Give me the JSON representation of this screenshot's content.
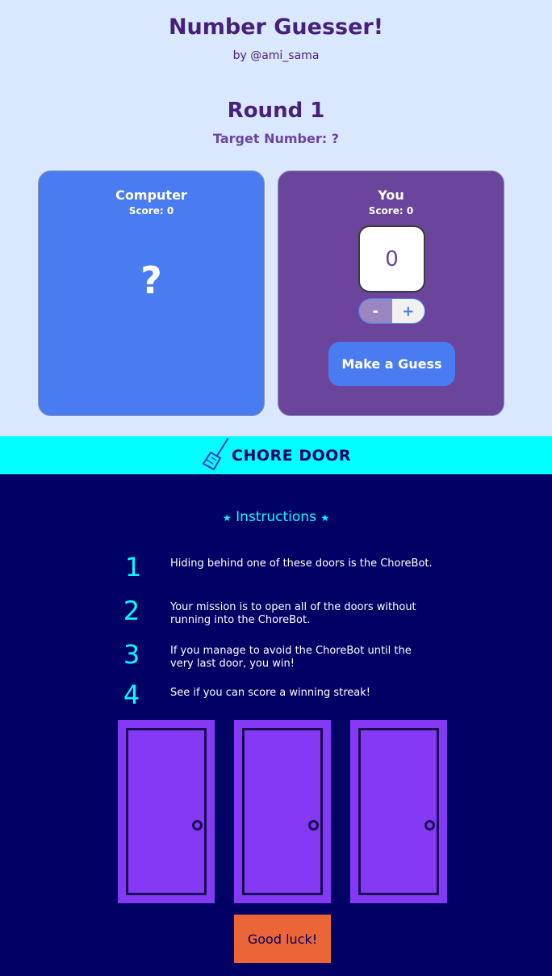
{
  "number_guesser": {
    "title": "Number Guesser!",
    "author": "by @ami_sama",
    "round_label": "Round 1",
    "target_label": "Target Number:",
    "target_value": "?",
    "computer": {
      "name": "Computer",
      "score_label": "Score:",
      "score": "0",
      "guess": "?"
    },
    "you": {
      "name": "You",
      "score_label": "Score:",
      "score": "0",
      "guess_value": "0",
      "minus_label": "-",
      "plus_label": "+",
      "guess_button": "Make a Guess"
    }
  },
  "chore_door": {
    "header_title": "CHORE DOOR",
    "instructions_title": "Instructions",
    "instructions": [
      {
        "num": "1",
        "text": "Hiding behind one of these doors is the ChoreBot."
      },
      {
        "num": "2",
        "text": "Your mission is to open all of the doors without running into the ChoreBot."
      },
      {
        "num": "3",
        "text": "If you manage to avoid the ChoreBot until the very last door, you win!"
      },
      {
        "num": "4",
        "text": "See if you can score a winning streak!"
      }
    ],
    "doors_count_visible": 3,
    "start_button": "Good luck!"
  },
  "colors": {
    "ng_background": "#d9e7ff",
    "ng_heading": "#46207a",
    "computer_card": "#4a7cf1",
    "you_card": "#6b449b",
    "cd_header": "#00ffff",
    "cd_background": "#010165",
    "door": "#8439f5",
    "start_button": "#eb6536"
  }
}
